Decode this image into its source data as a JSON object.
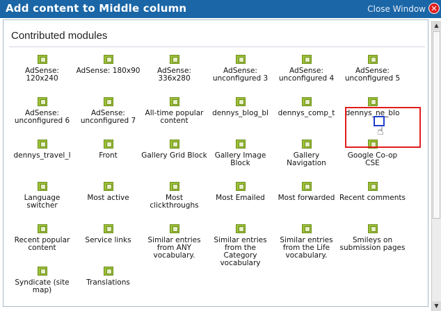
{
  "window": {
    "title": "Add content to Middle column",
    "close_label": "Close Window"
  },
  "section": {
    "title": "Contributed modules"
  },
  "modules": [
    [
      "AdSense: 120x240",
      "AdSense: 180x90",
      "AdSense: 336x280",
      "AdSense: unconfigured 3",
      "AdSense: unconfigured 4",
      "AdSense: unconfigured 5"
    ],
    [
      "AdSense: unconfigured 6",
      "AdSense: unconfigured 7",
      "All-time popular content",
      "dennys_blog_bl",
      "dennys_comp_t",
      "dennys_ne_blo"
    ],
    [
      "dennys_travel_l",
      "Front",
      "Gallery Grid Block",
      "Gallery Image Block",
      "Gallery Navigation",
      "Google Co-op CSE"
    ],
    [
      "Language switcher",
      "Most active",
      "Most clickthroughs",
      "Most Emailed",
      "Most forwarded",
      "Recent comments"
    ],
    [
      "Recent popular content",
      "Service links",
      "Similar entries from ANY vocabulary.",
      "Similar entries from the Category vocabulary",
      "Similar entries from the Life vocabulary.",
      "Smileys on submission pages"
    ],
    [
      "Syndicate (site map)",
      "Translations"
    ]
  ],
  "icon_name": "module-icon",
  "highlight_color": "#e21b1b"
}
